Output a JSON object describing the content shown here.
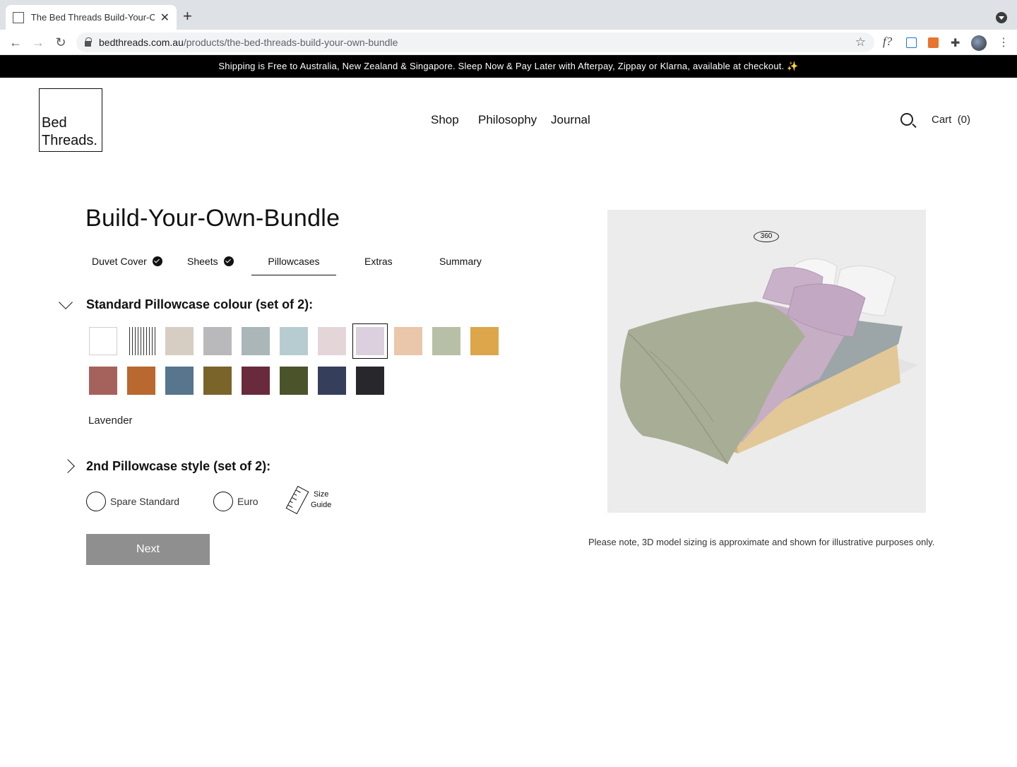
{
  "browser": {
    "tab_title": "The Bed Threads Build-Your-O",
    "url_host": "bedthreads.com.au",
    "url_path": "/products/the-bed-threads-build-your-own-bundle"
  },
  "announcement": "Shipping is Free to Australia, New Zealand & Singapore. Sleep Now & Pay Later with Afterpay, Zippay or Klarna, available at checkout. ✨",
  "header": {
    "logo_line1": "Bed",
    "logo_line2": "Threads.",
    "nav": [
      "Shop",
      "Philosophy",
      "Journal"
    ],
    "cart_label": "Cart",
    "cart_count": "(0)"
  },
  "builder": {
    "title": "Build-Your-Own-Bundle",
    "steps": [
      {
        "label": "Duvet Cover",
        "done": true
      },
      {
        "label": "Sheets",
        "done": true
      },
      {
        "label": "Pillowcases",
        "done": false,
        "active": true
      },
      {
        "label": "Extras",
        "done": false
      },
      {
        "label": "Summary",
        "done": false
      }
    ],
    "colour_section_title": "Standard Pillowcase colour (set of 2):",
    "swatches": [
      {
        "color": "#ffffff",
        "pattern": "plain"
      },
      {
        "color": "#ffffff",
        "pattern": "stripe"
      },
      {
        "color": "#d6cdc3"
      },
      {
        "color": "#b9b9bb"
      },
      {
        "color": "#aab6b7"
      },
      {
        "color": "#b7ccd1"
      },
      {
        "color": "#e4d6d8"
      },
      {
        "color": "#dbd0dd",
        "selected": true
      },
      {
        "color": "#eac6aa"
      },
      {
        "color": "#b8bfa7"
      },
      {
        "color": "#dda64a"
      },
      {
        "color": "#a5625c"
      },
      {
        "color": "#b9682f"
      },
      {
        "color": "#57758d"
      },
      {
        "color": "#7b6429"
      },
      {
        "color": "#6a2a3e"
      },
      {
        "color": "#4b532b"
      },
      {
        "color": "#353f5b"
      },
      {
        "color": "#27272c"
      }
    ],
    "selected_colour_name": "Lavender",
    "style_section_title": "2nd Pillowcase style (set of 2):",
    "style_options": [
      "Spare Standard",
      "Euro"
    ],
    "size_guide_line1": "Size",
    "size_guide_line2": "Guide",
    "next_label": "Next"
  },
  "viewer": {
    "badge": "360",
    "note": "Please note, 3D model sizing is approximate and shown for illustrative purposes only."
  }
}
